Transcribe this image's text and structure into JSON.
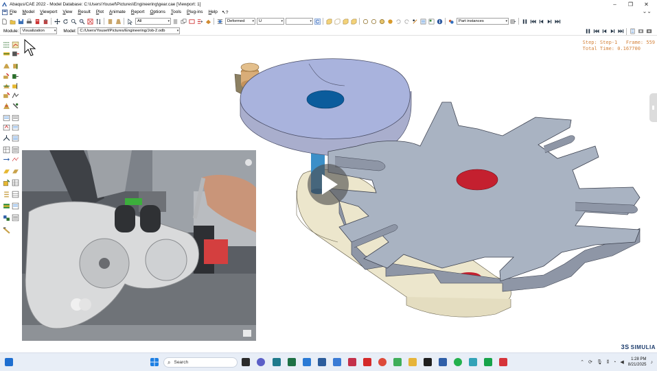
{
  "window": {
    "title": "Abaqus/CAE 2022 - Model Database: C:\\Users\\Yousef\\Pictures\\Engineering\\gear.cae [Viewport: 1]",
    "minimize_glyph": "–",
    "maximize_glyph": "❐",
    "close_glyph": "✕"
  },
  "menubar": {
    "items": [
      "File",
      "Model",
      "Viewport",
      "View",
      "Result",
      "Plot",
      "Animate",
      "Report",
      "Options",
      "Tools",
      "Plug-ins",
      "Help"
    ],
    "help_pointer": "?"
  },
  "toolbar": {
    "selection_filter": "All",
    "deformed_label": "Deformed",
    "field_output": "U",
    "field_component": "",
    "part_instances": "Part instances"
  },
  "context": {
    "module_label": "Module:",
    "module_value": "Visualization",
    "model_label": "Model:",
    "model_value": "C:/Users/Yousef/Pictures/Engineering/Job-2.odb"
  },
  "viewport": {
    "step_line": "Step: Step-1   Frame: 559",
    "time_line": "Total Time: 0.167700"
  },
  "watermark": {
    "brand": "SIMULIA",
    "brand_glyph": "3S"
  },
  "taskbar": {
    "search_placeholder": "Search",
    "time": "1:28 PM",
    "date": "8/21/2025"
  },
  "colors": {
    "gear_face": "#a9b3c2",
    "cam_face": "#a9b3dd",
    "hole_blue": "#0b5c9c",
    "hole_red": "#c4202f",
    "base_part": "#ece6cc",
    "step_text": "#d4823a",
    "taskbar_bg": "#e8eef7"
  },
  "icons": {
    "toolbox": [
      "create-field-output-icon",
      "xy-data-icon",
      "plot-contours-icon",
      "plot-symbols-icon",
      "animate-icon",
      "probe-icon",
      "query-icon",
      "display-group-icon",
      "cut-view-icon",
      "path-icon",
      "free-body-icon",
      "stream-icon",
      "material-orientation-icon",
      "section-points-icon",
      "overlay-plot-icon",
      "common-options-icon",
      "field-output-icon",
      "xy-plot-icon",
      "report-icon"
    ]
  }
}
